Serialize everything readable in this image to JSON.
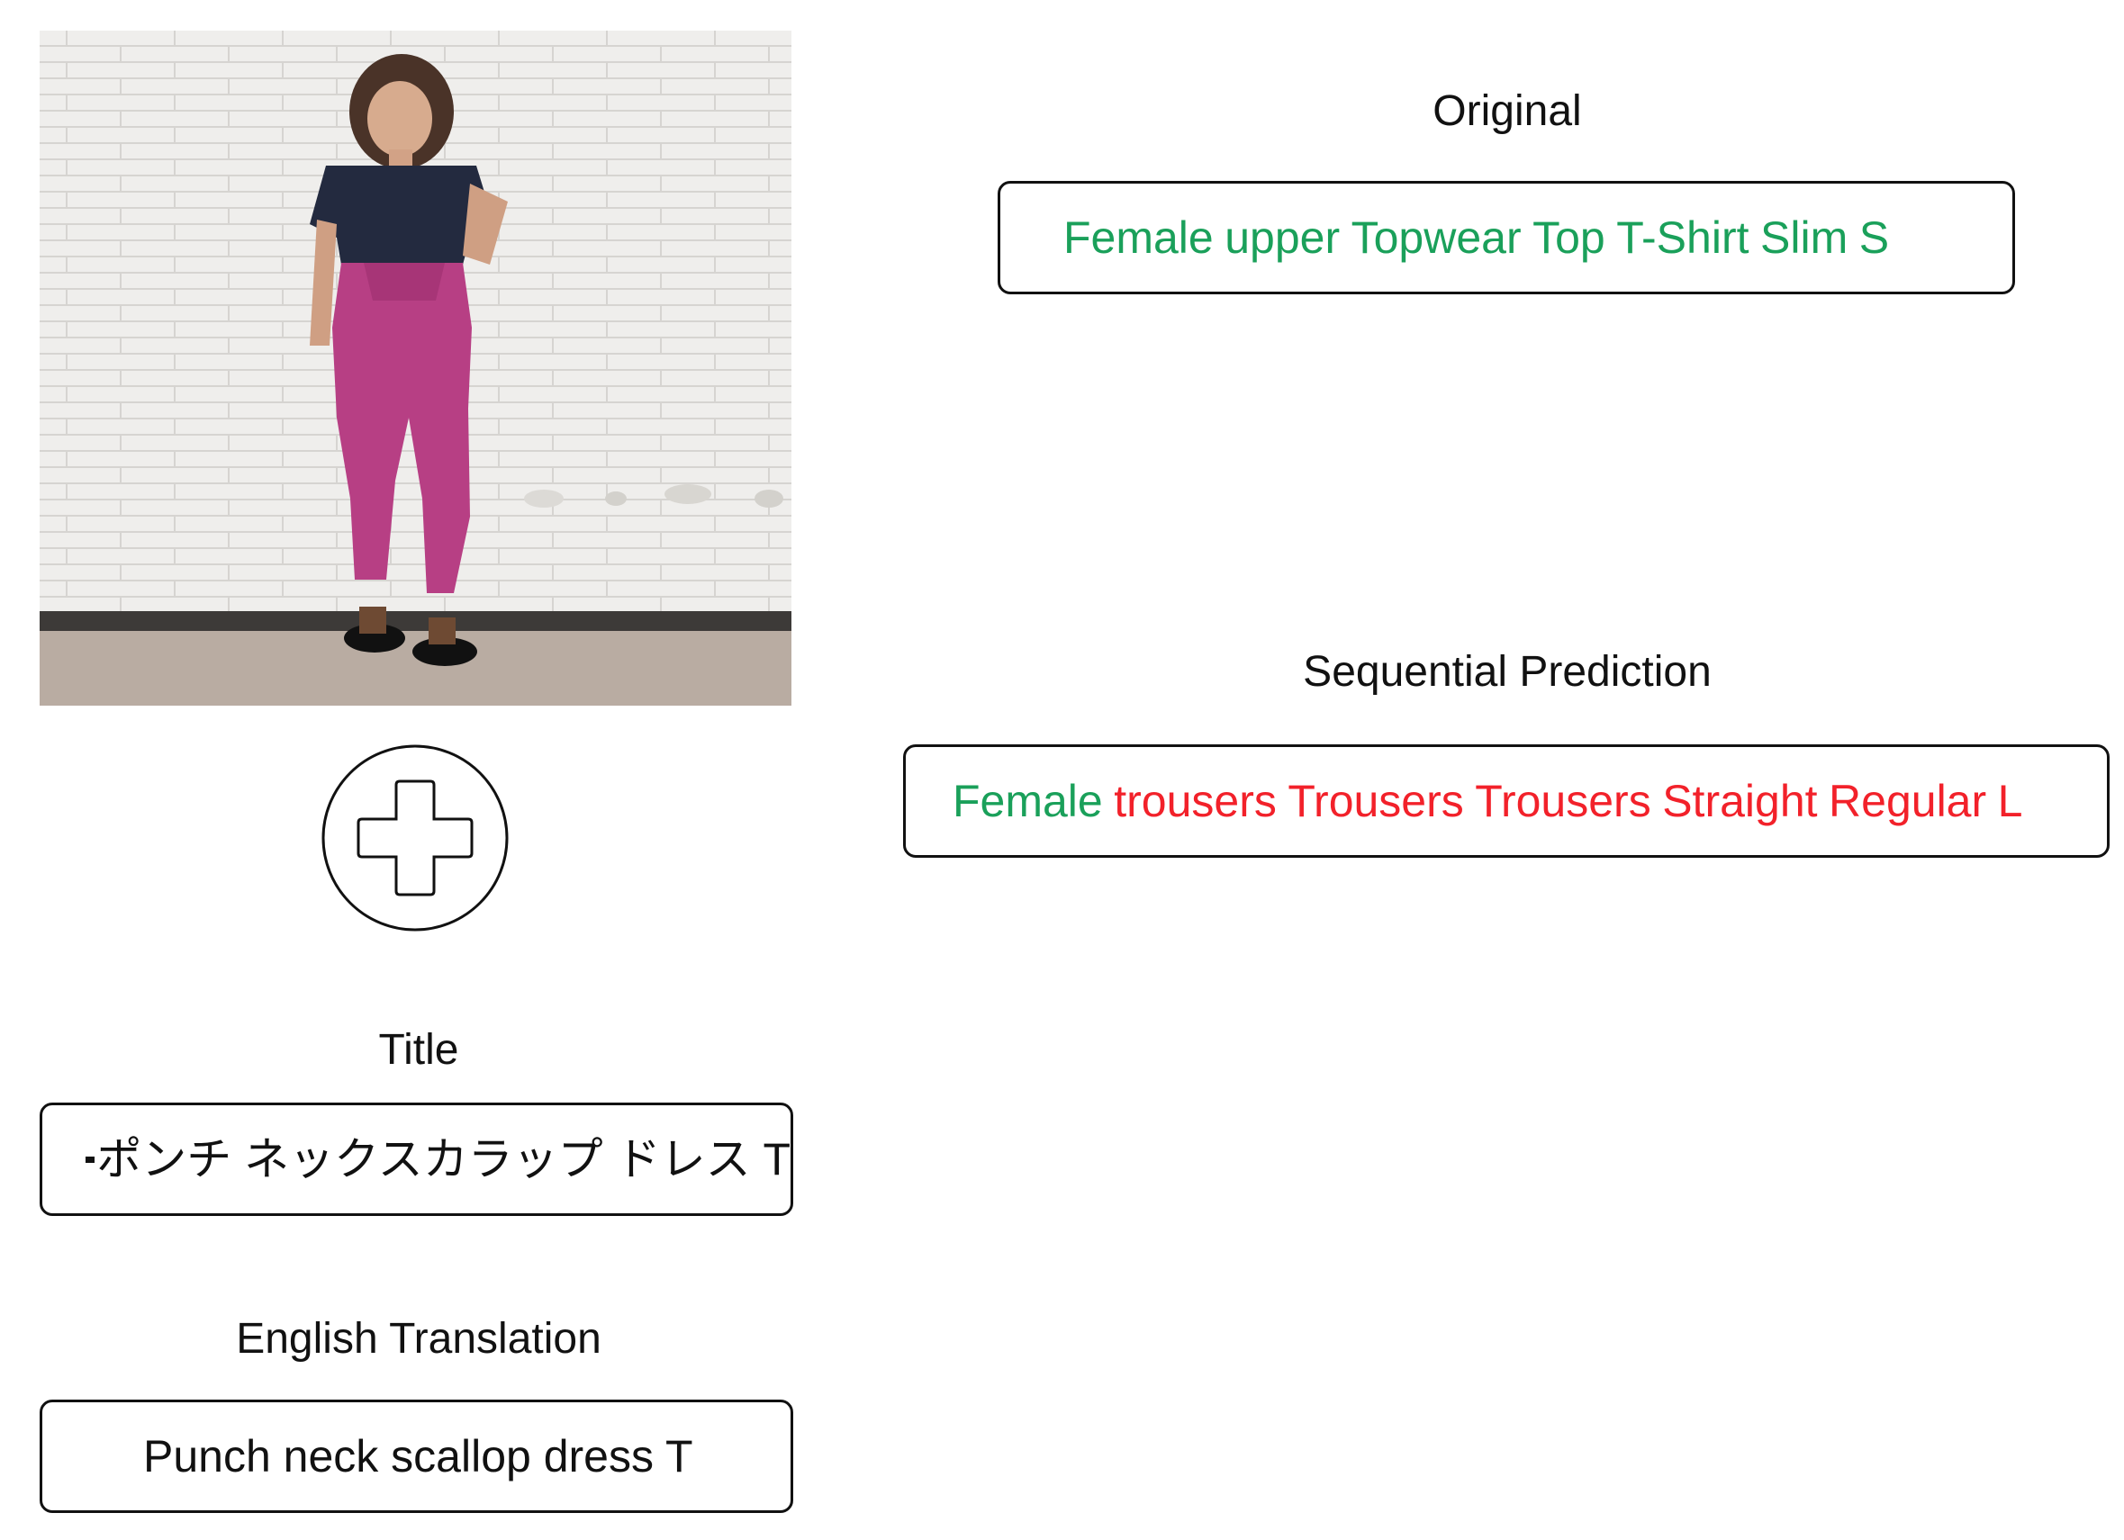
{
  "labels": {
    "original": "Original",
    "sequential_prediction": "Sequential Prediction",
    "title": "Title",
    "english_translation": "English Translation"
  },
  "original": {
    "tokens": [
      {
        "text": "Female",
        "status": "correct"
      },
      {
        "text": "upper",
        "status": "correct"
      },
      {
        "text": "Topwear",
        "status": "correct"
      },
      {
        "text": "Top",
        "status": "correct"
      },
      {
        "text": "T-Shirt",
        "status": "correct"
      },
      {
        "text": "Slim",
        "status": "correct"
      },
      {
        "text": "S",
        "status": "correct"
      }
    ]
  },
  "sequential_prediction": {
    "tokens": [
      {
        "text": "Female",
        "status": "correct"
      },
      {
        "text": "trousers",
        "status": "incorrect"
      },
      {
        "text": "Trousers",
        "status": "incorrect"
      },
      {
        "text": "Trousers",
        "status": "incorrect"
      },
      {
        "text": "Straight",
        "status": "incorrect"
      },
      {
        "text": "Regular",
        "status": "incorrect"
      },
      {
        "text": "L",
        "status": "incorrect"
      }
    ]
  },
  "title_text": "ポンチ ネックスカラップ ドレス T",
  "translation_text": "Punch neck scallop dress T",
  "colors": {
    "correct": "#1aa05a",
    "incorrect": "#f2212a",
    "text": "#111111",
    "border": "#111111"
  },
  "icons": {
    "combine": "plus-icon"
  }
}
